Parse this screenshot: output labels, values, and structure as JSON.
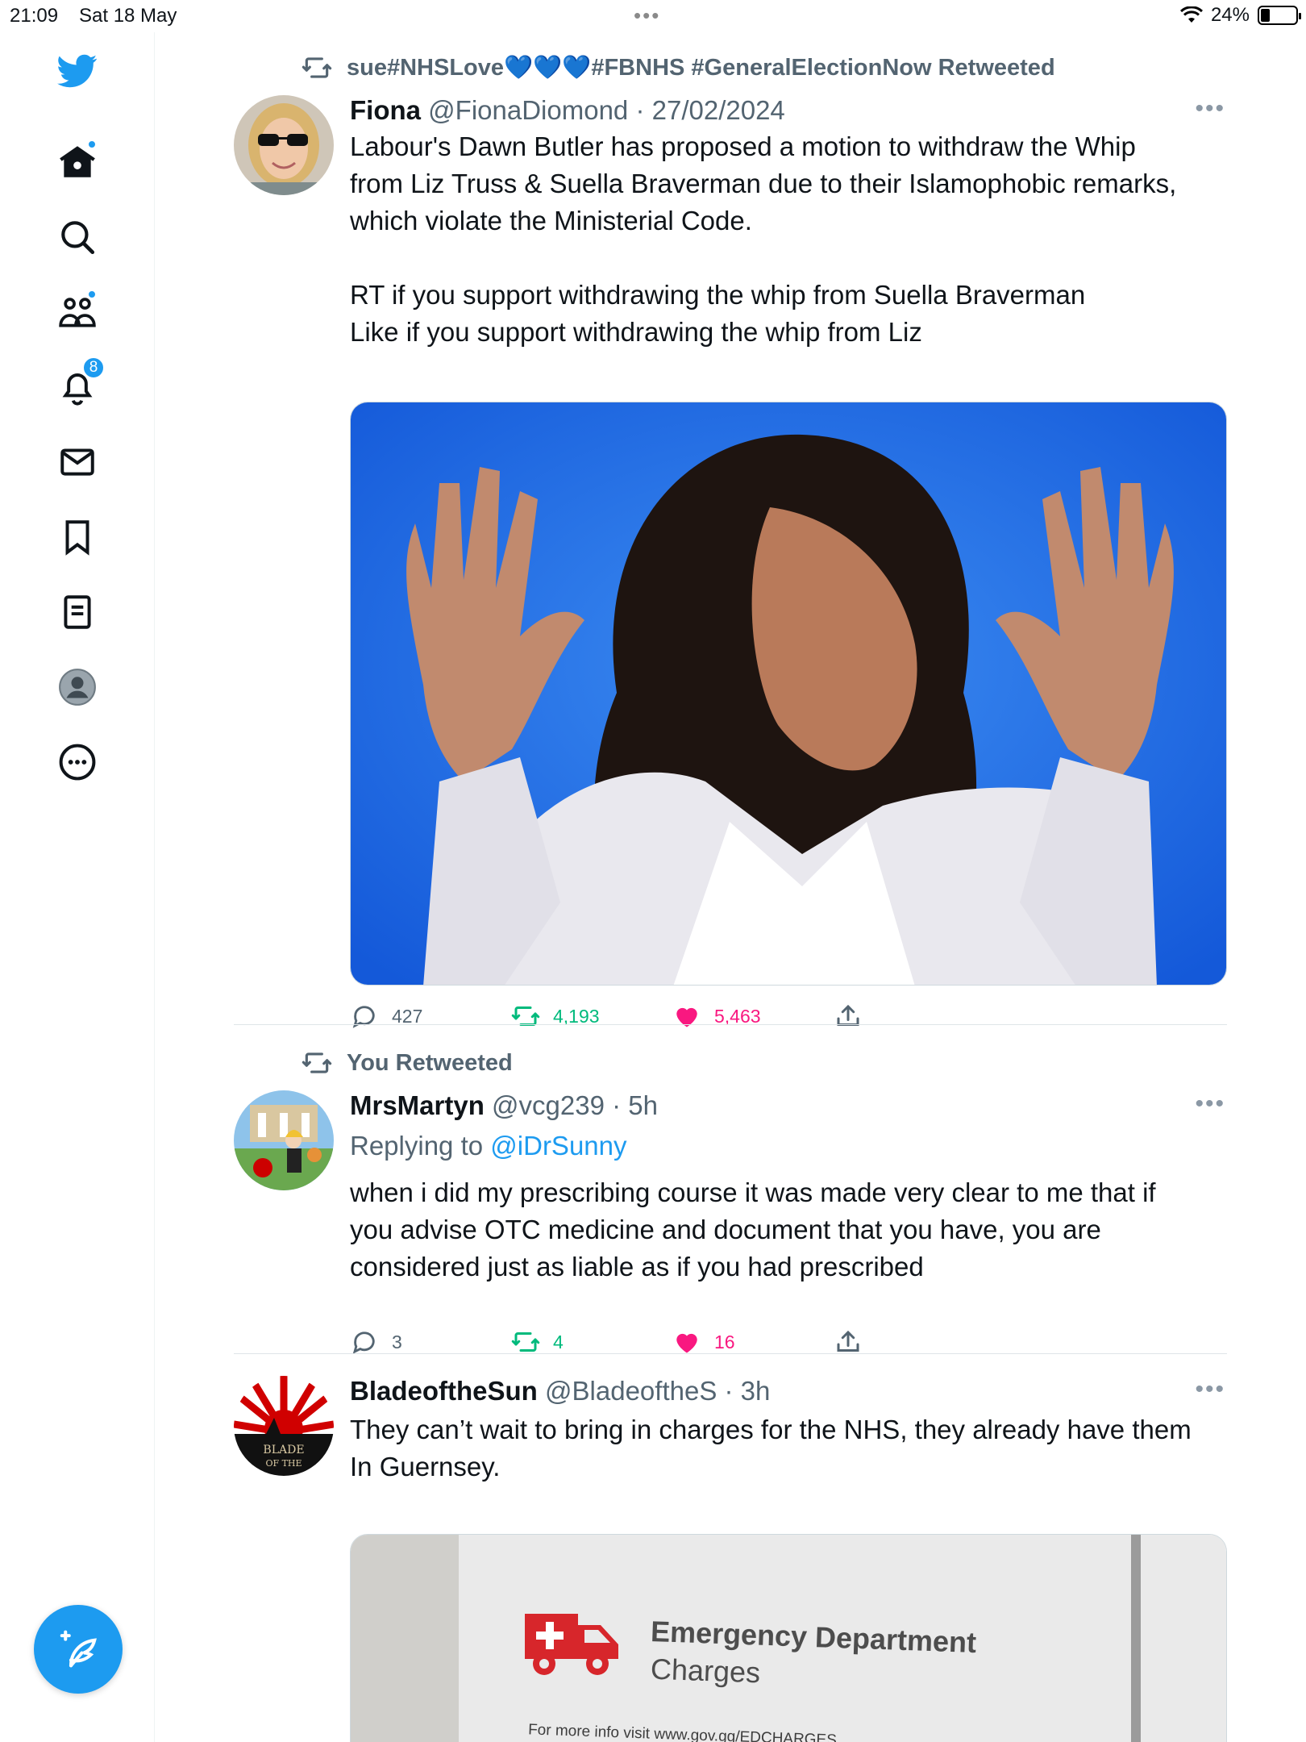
{
  "status_bar": {
    "time": "21:09",
    "date": "Sat 18 May",
    "battery": "24%",
    "battery_level": 0.24
  },
  "sidebar": {
    "notifications_count": "8"
  },
  "tweets": [
    {
      "context": "sue#NHSLove💙💙💙#FBNHS #GeneralElectionNow Retweeted",
      "name": "Fiona",
      "meta": "@FionaDiomond · 27/02/2024",
      "lines": [
        "Labour's Dawn Butler has proposed a motion to withdraw the Whip",
        "from Liz Truss & Suella Braverman due to their Islamophobic remarks,",
        "which violate the Ministerial Code.",
        "",
        "RT if you support withdrawing the whip from Suella Braverman",
        "Like if you support withdrawing the whip from Liz"
      ],
      "replies": "427",
      "retweets": "4,193",
      "likes": "5,463"
    },
    {
      "context": "You Retweeted",
      "name": "MrsMartyn",
      "meta": "@vcg239 · 5h",
      "reply_prefix": "Replying to",
      "reply_handle": "@iDrSunny",
      "lines": [
        "when i did my prescribing course it was made very clear to me that if",
        "you advise OTC medicine and document that you have, you are",
        "considered just as liable as if you had prescribed"
      ],
      "replies": "3",
      "retweets": "4",
      "likes": "16"
    },
    {
      "name": "BladeoftheSun",
      "meta": "@BladeoftheS · 3h",
      "avatar_text": "BLADE OF THE SUN",
      "lines": [
        "They can’t wait to bring in charges for the NHS, they already have them",
        "In Guernsey."
      ],
      "sign": {
        "title": "Emergency Department",
        "subtitle": "Charges",
        "info": "For more info visit www.gov.gg/EDCHARGES"
      }
    }
  ],
  "colors": {
    "accent": "#1d9bf0",
    "retweet": "#00ba7c",
    "like": "#f91880",
    "muted": "#536471"
  }
}
